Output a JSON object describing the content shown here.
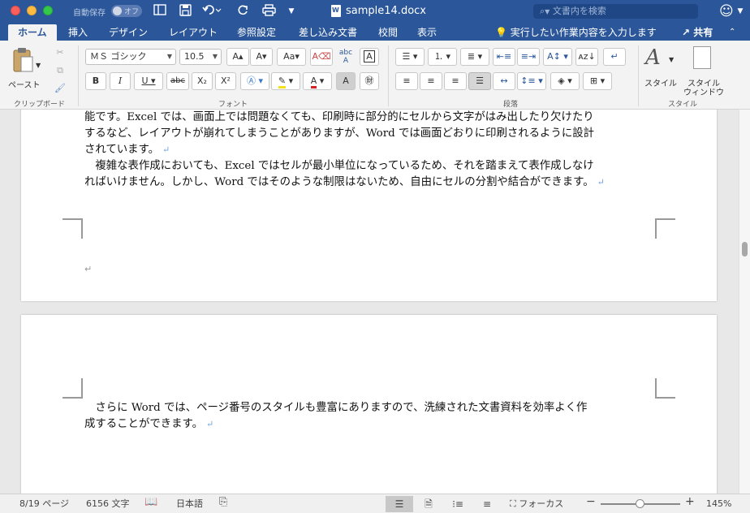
{
  "titlebar": {
    "autosave_label": "自動保存",
    "autosave_state": "オフ",
    "doc_title": "sample14.docx",
    "search_placeholder": "文書内を検索"
  },
  "tabs": [
    {
      "label": "ホーム",
      "active": true
    },
    {
      "label": "挿入"
    },
    {
      "label": "デザイン"
    },
    {
      "label": "レイアウト"
    },
    {
      "label": "参照設定"
    },
    {
      "label": "差し込み文書"
    },
    {
      "label": "校閲"
    },
    {
      "label": "表示"
    }
  ],
  "tellme": "実行したい作業内容を入力します",
  "share": "共有",
  "ribbon": {
    "clipboard": {
      "paste_label": "ペースト",
      "group_label": "クリップボード"
    },
    "font": {
      "font_name": "ＭＳ ゴシック",
      "font_size": "10.5",
      "group_label": "フォント"
    },
    "paragraph": {
      "group_label": "段落"
    },
    "styles": {
      "styles_label": "スタイル",
      "styles_window_label_1": "スタイル",
      "styles_window_label_2": "ウィンドウ",
      "group_label": "スタイル"
    }
  },
  "document": {
    "page1_lines": [
      "能です。Excel では、画面上では問題なくても、印刷時に部分的にセルから文字がはみ出したり欠けたり",
      "するなど、レイアウトが崩れてしまうことがありますが、Word では画面どおりに印刷されるように設計",
      "されています。",
      "　複雑な表作成においても、Excel ではセルが最小単位になっているため、それを踏まえて表作成しなけ",
      "ればいけません。しかし、Word ではそのような制限はないため、自由にセルの分割や結合ができます。"
    ],
    "page2_lines": [
      "　さらに Word では、ページ番号のスタイルも豊富にありますので、洗練された文書資料を効率よく作",
      "成することができます。"
    ]
  },
  "status": {
    "page": "8/19 ページ",
    "words": "6156 文字",
    "language": "日本語",
    "focus": "フォーカス",
    "zoom": "145%",
    "zoom_level": 0.49
  }
}
